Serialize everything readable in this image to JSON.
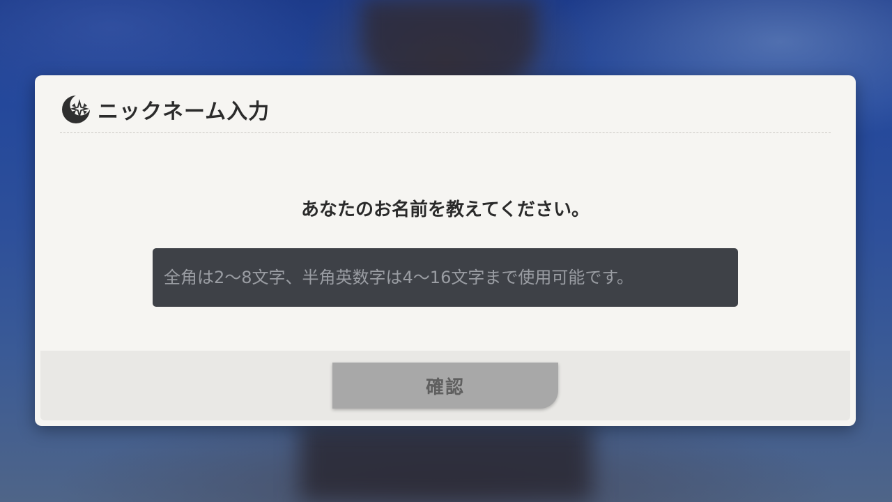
{
  "dialog": {
    "title": "ニックネーム入力",
    "icon": "compass-star-icon",
    "prompt": "あなたのお名前を教えてください。",
    "input": {
      "value": "",
      "placeholder": "全角は2〜8文字、半角英数字は4〜16文字まで使用可能です。"
    },
    "confirm_label": "確認"
  },
  "colors": {
    "dialog_bg": "#f6f5f2",
    "input_bg": "#3e4147",
    "button_bg": "#a8a8a8",
    "title_text": "#2b2b2b"
  }
}
